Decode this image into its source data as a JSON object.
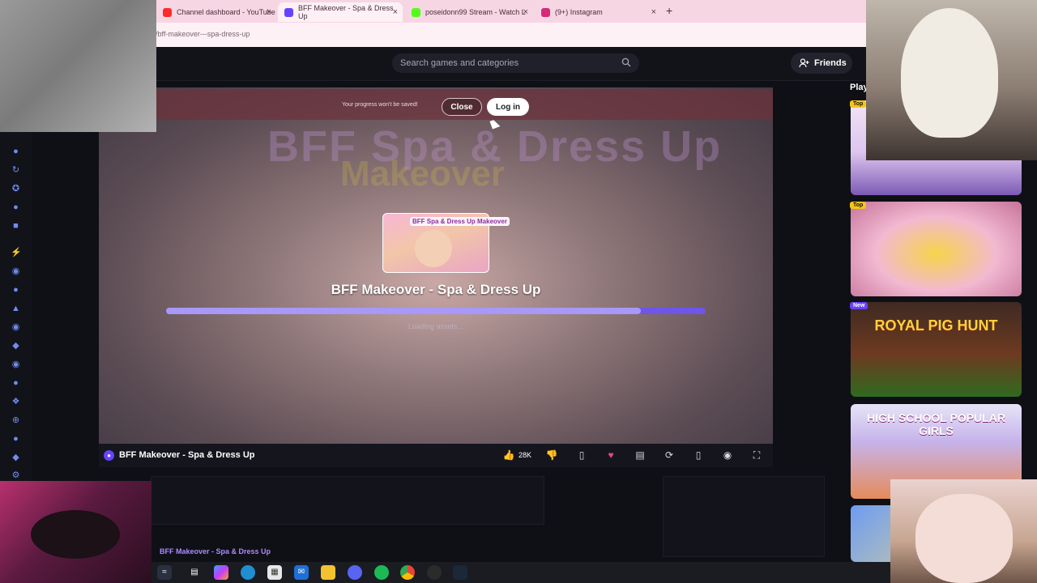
{
  "browser": {
    "tabs": [
      {
        "title": "Channel dashboard - YouTube",
        "active": false
      },
      {
        "title": "BFF Makeover - Spa & Dress Up",
        "active": true
      },
      {
        "title": "poseidonn99 Stream - Watch L",
        "active": false
      },
      {
        "title": "(9+) Instagram",
        "active": false
      }
    ],
    "url": "/bff-makeover---spa-dress-up",
    "new_tab": "+",
    "tab_close": "×"
  },
  "header": {
    "search_placeholder": "Search games and categories",
    "friends_label": "Friends"
  },
  "banner": {
    "text": "Your progress won't be saved!",
    "close_label": "Close",
    "login_label": "Log in"
  },
  "game": {
    "thumbnail_title": "BFF Spa & Dress Up Makeover",
    "title": "BFF Makeover - Spa & Dress Up",
    "loading_text": "Loading assets...",
    "progress": 0.88,
    "bg_title_1": "BFF Spa & Dress Up",
    "bg_title_2": "Makeover"
  },
  "gamebar": {
    "title": "BFF Makeover - Spa & Dress Up",
    "like_count": "28K"
  },
  "breadcrumb": "BFF Makeover - Spa & Dress Up",
  "right_column": {
    "heading": "Play",
    "cards": [
      {
        "badge": "Top",
        "text": ""
      },
      {
        "badge": "Top",
        "text": ""
      },
      {
        "badge": "New",
        "text": "ROYAL PIG HUNT"
      },
      {
        "badge": "",
        "text": "HIGH SCHOOL POPULAR GIRLS"
      }
    ]
  },
  "colors": {
    "accent": "#6842ff",
    "progress": "#a898f8",
    "badge_top": "#f5c518",
    "badge_new": "#6842ff"
  }
}
